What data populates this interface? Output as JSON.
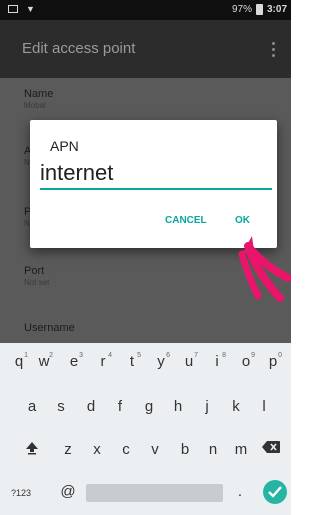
{
  "status": {
    "battery": "97%",
    "time": "3:07"
  },
  "toolbar": {
    "title": "Edit access point"
  },
  "settings": [
    {
      "label": "Name",
      "value": "Mobal"
    },
    {
      "label": "A",
      "value": "N"
    },
    {
      "label": "P",
      "value": "N"
    },
    {
      "label": "Port",
      "value": "Not set"
    },
    {
      "label": "Username",
      "value": ""
    }
  ],
  "dialog": {
    "title": "APN",
    "value": "internet",
    "cancel": "CANCEL",
    "ok": "OK"
  },
  "colors": {
    "accent": "#0aa79f",
    "pointer": "#e8156b"
  },
  "keyboard": {
    "row1": [
      {
        "k": "q",
        "n": "1"
      },
      {
        "k": "w",
        "n": "2"
      },
      {
        "k": "e",
        "n": "3"
      },
      {
        "k": "r",
        "n": "4"
      },
      {
        "k": "t",
        "n": "5"
      },
      {
        "k": "y",
        "n": "6"
      },
      {
        "k": "u",
        "n": "7"
      },
      {
        "k": "i",
        "n": "8"
      },
      {
        "k": "o",
        "n": "9"
      },
      {
        "k": "p",
        "n": "0"
      }
    ],
    "row2": [
      "a",
      "s",
      "d",
      "f",
      "g",
      "h",
      "j",
      "k",
      "l"
    ],
    "row3": [
      "z",
      "x",
      "c",
      "v",
      "b",
      "n",
      "m"
    ],
    "symbols": "?123",
    "at": "@",
    "period": "."
  }
}
